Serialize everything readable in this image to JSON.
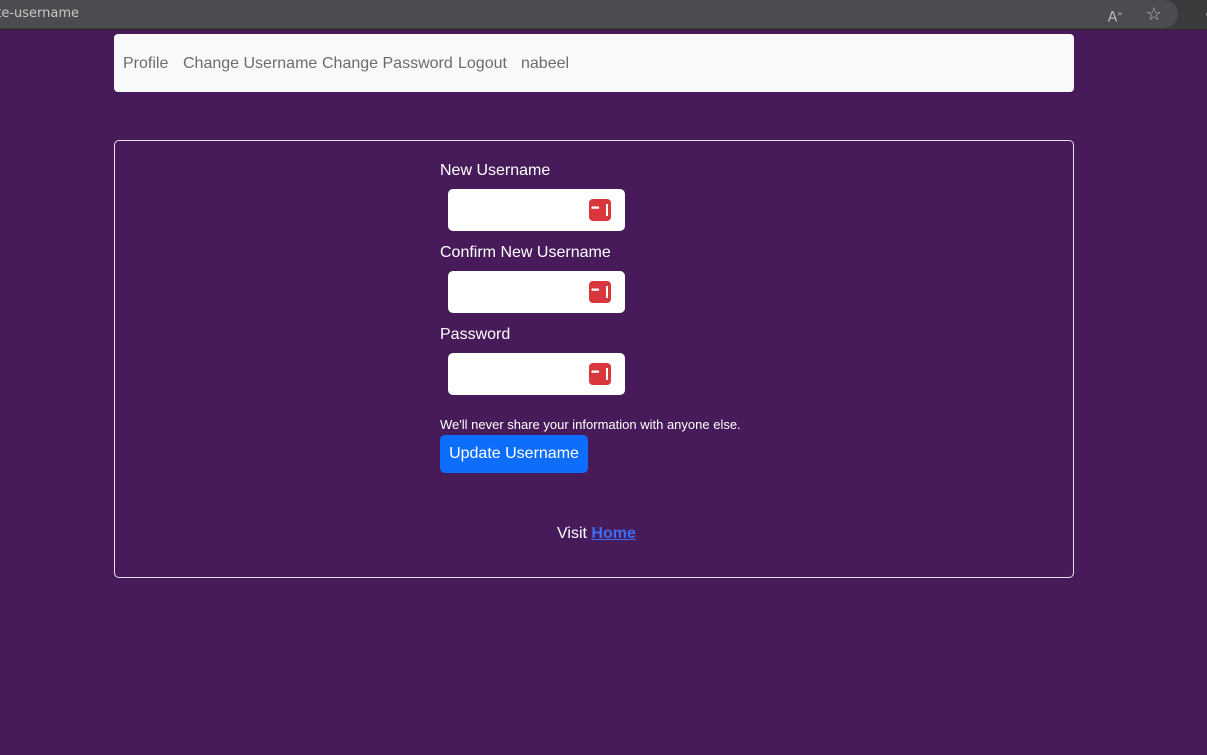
{
  "browser": {
    "url_text": "date-username",
    "read_aloud_icon": "read-aloud-icon",
    "favorite_icon": "star-icon",
    "extension_icon": "extension-icon"
  },
  "navbar": {
    "items": [
      {
        "label": "Profile"
      },
      {
        "label": "Change Username"
      },
      {
        "label": "Change Password"
      },
      {
        "label": "Logout"
      },
      {
        "label": "nabeel"
      }
    ]
  },
  "form": {
    "new_username_label": "New Username",
    "new_username_value": "",
    "confirm_username_label": "Confirm New Username",
    "confirm_username_value": "",
    "password_label": "Password",
    "password_value": "",
    "password_manager_icon": "password-manager-icon",
    "help_text": "We'll never share your information with anyone else.",
    "submit_label": "Update Username"
  },
  "footer": {
    "visit_text": "Visit ",
    "home_link": "Home"
  },
  "colors": {
    "page_background": "#471b5a",
    "primary_button": "#0d6efd",
    "password_icon": "#d9363e",
    "navbar_background": "#f8f9fa"
  }
}
